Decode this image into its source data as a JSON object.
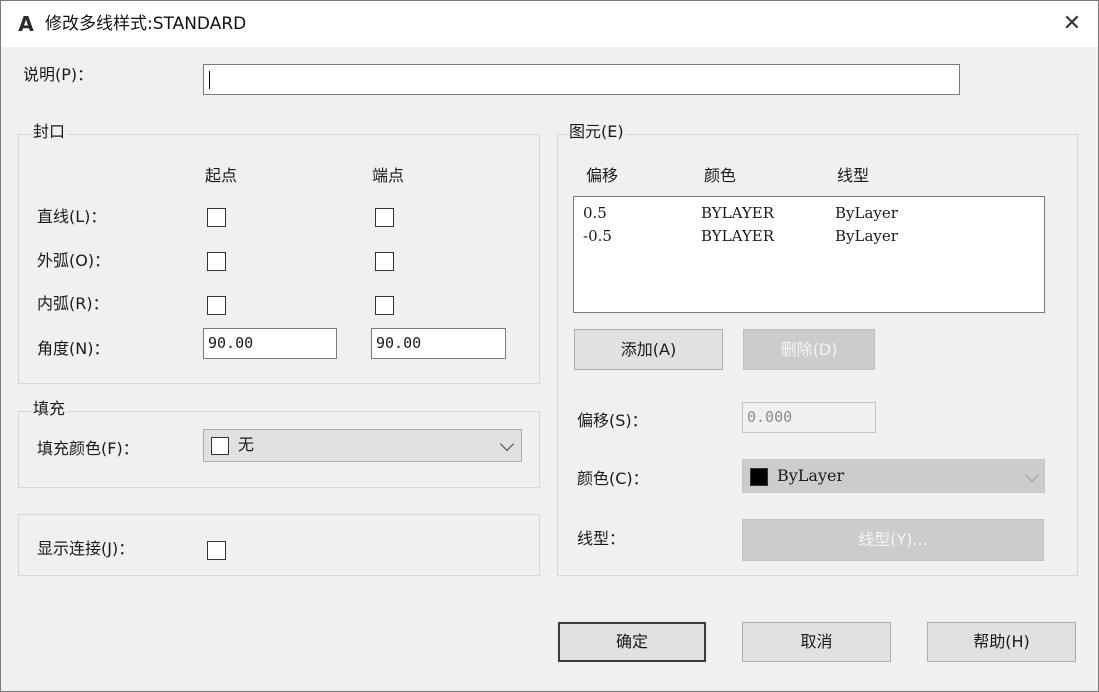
{
  "titlebar": {
    "icon": "A",
    "title": "修改多线样式:STANDARD",
    "close_glyph": "✕"
  },
  "description": {
    "label": "说明(P)：",
    "value": ""
  },
  "caps": {
    "group_label": "封口",
    "col_start": "起点",
    "col_end": "端点",
    "line_label": "直线(L)：",
    "outer_arc_label": "外弧(O)：",
    "inner_arc_label": "内弧(R)：",
    "angle_label": "角度(N)：",
    "angle_start": "90.00",
    "angle_end": "90.00",
    "line_start_checked": false,
    "line_end_checked": false,
    "outer_start_checked": false,
    "outer_end_checked": false,
    "inner_start_checked": false,
    "inner_end_checked": false
  },
  "fill": {
    "group_label": "填充",
    "color_label": "填充颜色(F)：",
    "color_value": "无",
    "swatch_color": "#ffffff"
  },
  "joints": {
    "label": "显示连接(J)：",
    "checked": false
  },
  "elements": {
    "group_label": "图元(E)",
    "headers": {
      "offset": "偏移",
      "color": "颜色",
      "linetype": "线型"
    },
    "rows": [
      {
        "offset": "0.5",
        "color": "BYLAYER",
        "linetype": "ByLayer"
      },
      {
        "offset": "-0.5",
        "color": "BYLAYER",
        "linetype": "ByLayer"
      }
    ],
    "add_button": "添加(A)",
    "delete_button": "删除(D)",
    "offset_label": "偏移(S)：",
    "offset_value": "0.000",
    "color_label": "颜色(C)：",
    "color_value": "ByLayer",
    "color_swatch": "#000000",
    "linetype_label": "线型：",
    "linetype_button": "线型(Y)..."
  },
  "footer": {
    "ok": "确定",
    "cancel": "取消",
    "help": "帮助(H)"
  }
}
